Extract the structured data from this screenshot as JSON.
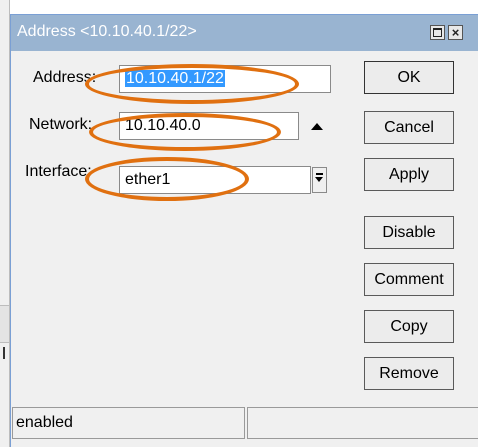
{
  "window": {
    "title": "Address <10.10.40.1/22>",
    "maximize_icon": "maximize-icon",
    "close_glyph": "×"
  },
  "form": {
    "address_label": "Address:",
    "address_value": "10.10.40.1/22",
    "network_label": "Network:",
    "network_value": "10.10.40.0",
    "interface_label": "Interface:",
    "interface_value": "ether1",
    "interface_selected": "ether1"
  },
  "buttons": {
    "ok": "OK",
    "cancel": "Cancel",
    "apply": "Apply",
    "disable": "Disable",
    "comment": "Comment",
    "copy": "Copy",
    "remove": "Remove"
  },
  "status": {
    "left": "enabled",
    "right": ""
  },
  "colors": {
    "titlebar": "#99b4d1",
    "selection": "#3399ff",
    "annotation": "#e07010",
    "dialog_bg": "#f0f0f0"
  },
  "icons": {
    "network_toggle": "triangle-up-icon",
    "interface_dropdown": "dropdown-arrow-icon"
  }
}
